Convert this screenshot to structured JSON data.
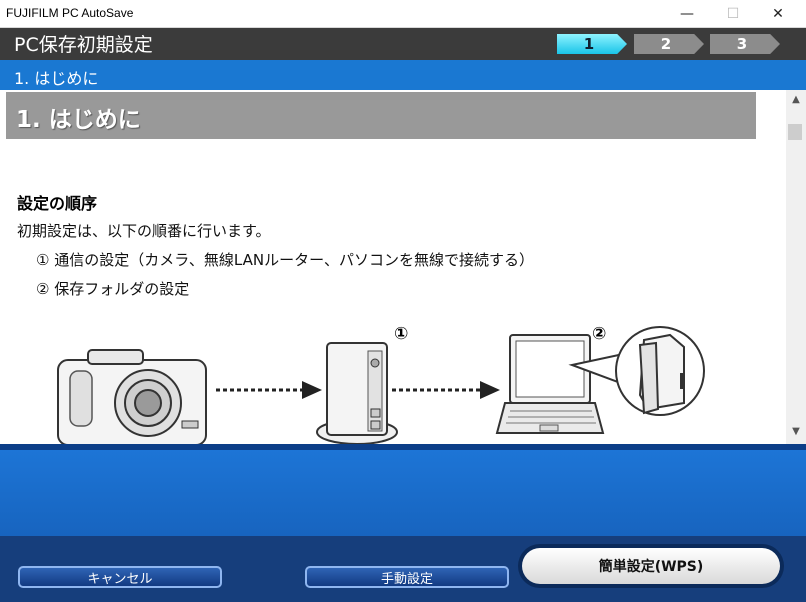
{
  "window": {
    "title": "FUJIFILM PC AutoSave",
    "minimize_glyph": "—",
    "maximize_glyph": "☐",
    "close_glyph": "✕"
  },
  "header": {
    "title": "PC保存初期設定",
    "steps": [
      {
        "label": "1",
        "active": true
      },
      {
        "label": "2",
        "active": false
      },
      {
        "label": "3",
        "active": false
      }
    ]
  },
  "section": {
    "title": "1. はじめに"
  },
  "content": {
    "heading": "1. はじめに",
    "subheading": "設定の順序",
    "intro": "初期設定は、以下の順番に行います。",
    "step1": "① 通信の設定（カメラ、無線LANルーター、パソコンを無線で接続する）",
    "step2": "② 保存フォルダの設定",
    "illustration": {
      "marker1": "①",
      "marker2": "②",
      "icons": [
        "camera-icon",
        "router-icon",
        "laptop-icon",
        "folder-icon"
      ]
    }
  },
  "scrollbar": {
    "up": "▲",
    "down": "▼"
  },
  "footer": {
    "cancel_label": "キャンセル",
    "manual_label": "手動設定",
    "wps_label": "簡単設定(WPS)"
  },
  "colors": {
    "header_bg": "#3b3b3b",
    "section_bg": "#1a78d2",
    "step_active": "#19c4e8",
    "step_inactive": "#8c8c8c",
    "footer_bg": "#163e7c"
  }
}
